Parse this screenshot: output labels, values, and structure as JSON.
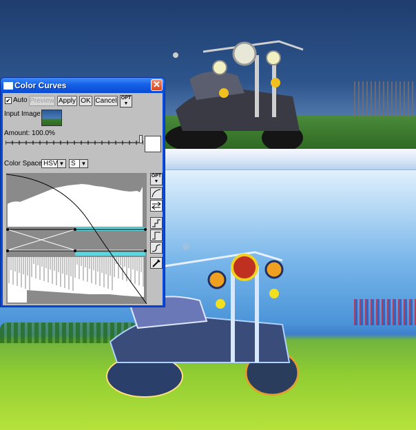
{
  "window": {
    "title": "Color Curves",
    "close_glyph": "✕"
  },
  "toolbar": {
    "auto_label": "Auto",
    "auto_checked": true,
    "preview_label": "Preview",
    "apply_label": "Apply",
    "ok_label": "OK",
    "cancel_label": "Cancel",
    "opt_label": "OPT"
  },
  "input_image": {
    "label": "Input Image:"
  },
  "amount": {
    "label": "Amount: 100.0%",
    "percent": 100
  },
  "color_space": {
    "label": "Color Space:",
    "space_value": "HSV",
    "channel_value": "S",
    "arrow_glyph": "🡇"
  },
  "side_tools": {
    "opt_label": "OPT",
    "tools": [
      "curve-tool-icon",
      "swap-arrows-icon",
      "step-up-icon",
      "linear-tool-icon",
      "smooth-curve-icon",
      "eyedropper-icon"
    ]
  },
  "colors": {
    "titlebar": "#0a4bd4",
    "dialog_face": "#c0c0c0",
    "curve_bg": "#8a8a8a",
    "channel_bar": "#5ed6dd"
  }
}
